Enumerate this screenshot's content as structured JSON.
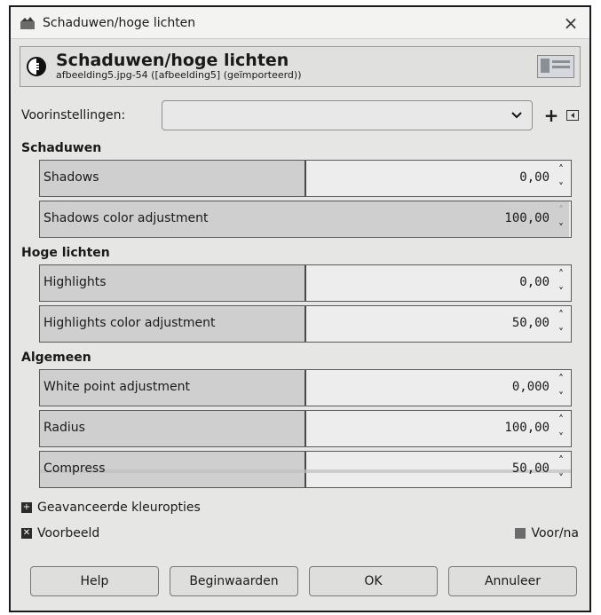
{
  "window": {
    "title": "Schaduwen/hoge lichten",
    "close_glyph": "×"
  },
  "header": {
    "title": "Schaduwen/hoge lichten",
    "subtitle": "afbeelding5.jpg-54 ([afbeelding5] (geïmporteerd))"
  },
  "presets": {
    "label": "Voorinstellingen:",
    "value": "",
    "plus": "+"
  },
  "sections": {
    "shadows_title": "Schaduwen",
    "highlights_title": "Hoge lichten",
    "general_title": "Algemeen"
  },
  "fields": {
    "shadows": {
      "label": "Shadows",
      "value": "0,00"
    },
    "shadows_color": {
      "label": "Shadows color adjustment",
      "value": "100,00"
    },
    "highlights": {
      "label": "Highlights",
      "value": "0,00"
    },
    "highlights_color": {
      "label": "Highlights color adjustment",
      "value": "50,00"
    },
    "white_point": {
      "label": "White point adjustment",
      "value": "0,000"
    },
    "radius": {
      "label": "Radius",
      "value": "100,00"
    },
    "compress": {
      "label": "Compress",
      "value": "50,00"
    }
  },
  "advanced": {
    "label": "Geavanceerde kleuropties"
  },
  "preview": {
    "label": "Voorbeeld",
    "before_after": "Voor/na"
  },
  "buttons": {
    "help": "Help",
    "reset": "Beginwaarden",
    "ok": "OK",
    "cancel": "Annuleer"
  },
  "colors": {
    "window_bg": "#e6e6e5",
    "slider_fill": "#cfcfcf"
  }
}
